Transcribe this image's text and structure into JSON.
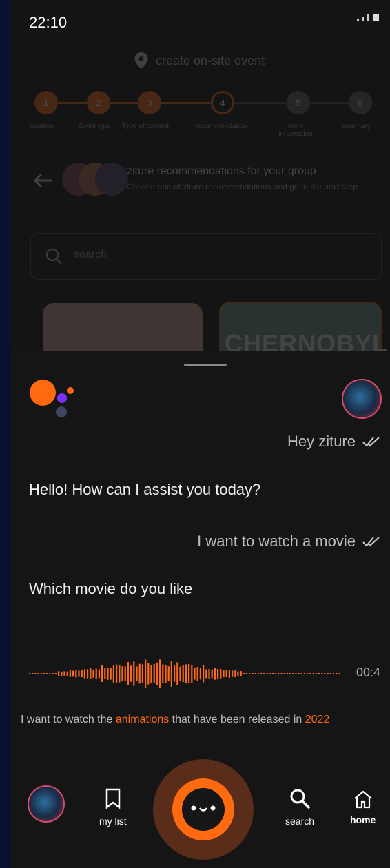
{
  "status_bar": {
    "time": "22:10"
  },
  "background_screen": {
    "title": "create on-site event",
    "steps": [
      {
        "number": "1",
        "label": "location",
        "state": "done"
      },
      {
        "number": "2",
        "label": "Event type",
        "state": "done"
      },
      {
        "number": "3",
        "label": "Type of content",
        "state": "done"
      },
      {
        "number": "4",
        "label": "recommendation",
        "state": "current"
      },
      {
        "number": "5",
        "label": "more information",
        "state": "todo"
      },
      {
        "number": "6",
        "label": "summary",
        "state": "todo"
      }
    ],
    "recommendation": {
      "title": "ziture recommendations for your group",
      "description": "Choose one of ziture recommendations and go to the next step"
    },
    "search_placeholder": "search",
    "card_text": "CHERNOBYL"
  },
  "chat": {
    "messages": [
      {
        "from": "user",
        "text": "Hey ziture"
      },
      {
        "from": "assistant",
        "text": "Hello! How can I assist you today?"
      },
      {
        "from": "user",
        "text": "I want to watch a movie"
      },
      {
        "from": "assistant",
        "text": "Which movie do you like"
      }
    ],
    "voice_duration": "00:4",
    "transcript": {
      "part1": "I want to watch the ",
      "highlight1": "animations",
      "part2": " that have been released in ",
      "highlight2": "2022"
    }
  },
  "nav": {
    "mylist_label": "my list",
    "search_label": "search",
    "home_label": "home"
  },
  "colors": {
    "accent": "#ff6a1a",
    "background": "#141414",
    "purple": "#7b2ff7"
  }
}
